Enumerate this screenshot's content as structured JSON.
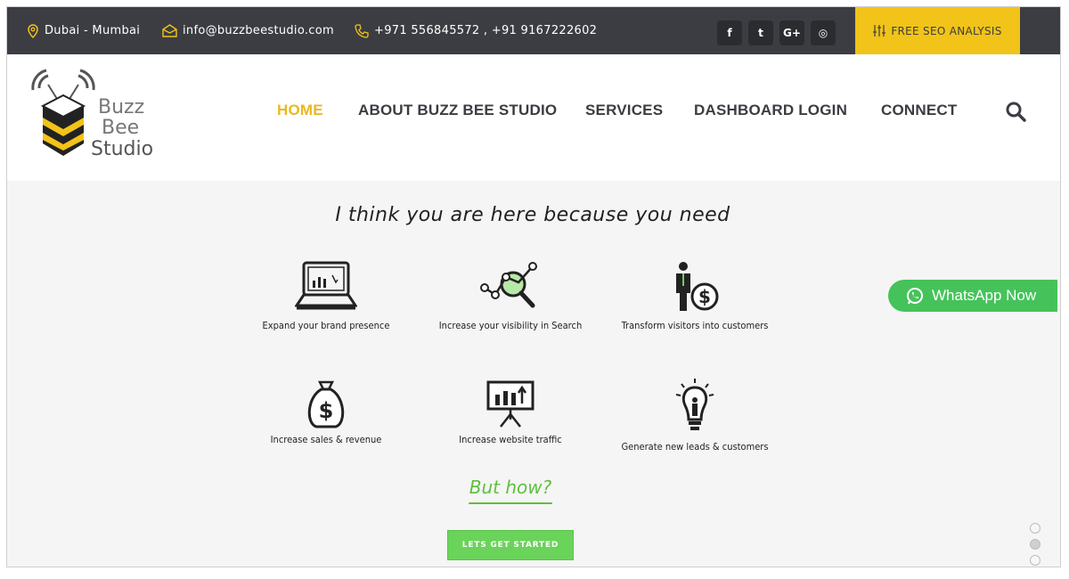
{
  "topbar": {
    "location": "Dubai - Mumbai",
    "email": "info@buzzbeestudio.com",
    "phone": "+971 556845572 , +91 9167222602",
    "social": [
      {
        "icon": "facebook-icon",
        "glyph": "f"
      },
      {
        "icon": "twitter-icon",
        "glyph": "t"
      },
      {
        "icon": "google-plus-icon",
        "glyph": "G+"
      },
      {
        "icon": "instagram-icon",
        "glyph": "◎"
      }
    ],
    "seo_label": "FREE SEO ANALYSIS"
  },
  "logo": {
    "line1": "Buzz",
    "line2": "Bee",
    "line3": "Studio"
  },
  "nav": {
    "home": "HOME",
    "about": "ABOUT BUZZ BEE STUDIO",
    "services": "SERVICES",
    "dashboard": "DASHBOARD LOGIN",
    "connect": "CONNECT"
  },
  "main": {
    "headline": "I think you are here because you need",
    "features": [
      {
        "caption": "Expand your brand presence",
        "icon": "laptop-chart-icon"
      },
      {
        "caption": "Increase your visibility in Search",
        "icon": "search-network-icon"
      },
      {
        "caption": "Transform visitors into customers",
        "icon": "person-dollar-icon"
      },
      {
        "caption": "Increase sales & revenue",
        "icon": "money-bag-icon"
      },
      {
        "caption": "Increase website traffic",
        "icon": "presentation-board-icon"
      },
      {
        "caption": "Generate new leads & customers",
        "icon": "lightbulb-person-icon"
      }
    ],
    "but_how": "But how?",
    "cta_label": "LETS GET STARTED"
  },
  "whatsapp": {
    "label": "WhatsApp Now"
  },
  "slider": {
    "dots": 5,
    "active_index": 1
  },
  "colors": {
    "topbar": "#3b3d42",
    "accent_yellow": "#f2c318",
    "nav_active": "#e9b920",
    "green": "#6ad35a",
    "whatsapp": "#45c35a"
  }
}
